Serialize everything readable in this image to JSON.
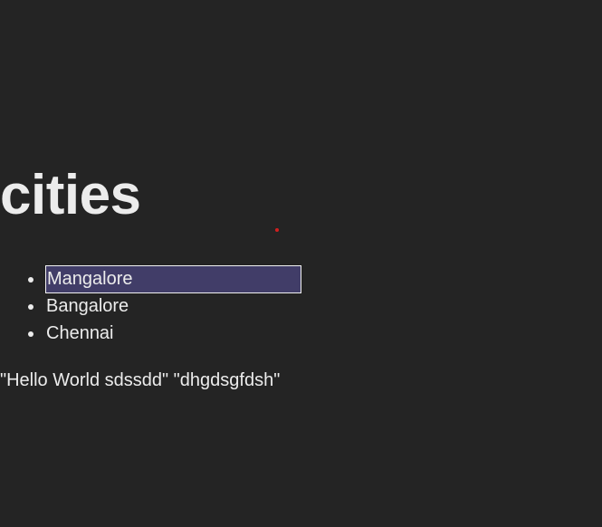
{
  "heading": "cities",
  "cities": [
    {
      "label": "Mangalore",
      "selected": true
    },
    {
      "label": "Bangalore",
      "selected": false
    },
    {
      "label": "Chennai",
      "selected": false
    }
  ],
  "quote_text": "\"Hello World sdssdd\" \"dhgdsgfdsh\"",
  "colors": {
    "background": "#242424",
    "text": "#ececec",
    "selection": "#413d68",
    "cursor_dot": "#d21f1f"
  }
}
